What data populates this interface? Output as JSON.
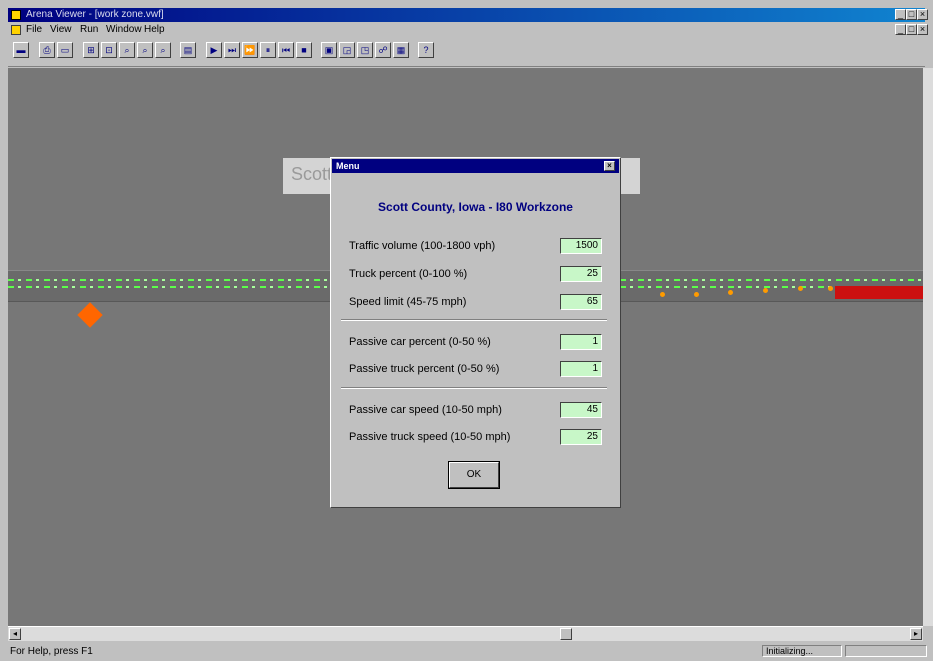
{
  "window": {
    "title": "Arena Viewer - [work zone.vwf]",
    "controls": [
      "_",
      "□",
      "×"
    ]
  },
  "menu": [
    "File",
    "View",
    "Run",
    "Window",
    "Help"
  ],
  "toolbar": {
    "icons": [
      "open-icon",
      "print-icon",
      "print-preview-icon",
      "zoom-fit-icon",
      "zoom-all-icon",
      "zoom-in-icon",
      "zoom-out-icon",
      "zoom-custom-icon",
      "animate-icon",
      "run-icon",
      "step-icon",
      "fast-forward-icon",
      "pause-icon",
      "go-icon",
      "stop-icon",
      "view-1-icon",
      "view-2-icon",
      "view-3-icon",
      "view-4-icon",
      "view-5-icon",
      "help-icon"
    ],
    "glyphs": [
      "▬",
      "⎙",
      "▭",
      "⊞",
      "⊡",
      "⌕",
      "⌕",
      "⌕",
      "▤",
      "▶",
      "⏭",
      "⏩",
      "⏸",
      "⏮",
      "■",
      "▣",
      "◲",
      "◳",
      "☍",
      "▦",
      "?"
    ]
  },
  "workspace": {
    "banner_text": "Scott",
    "colors": {
      "background": "#777777",
      "lane": "#5cff4a",
      "workzone": "#cc1010",
      "vehicle": "#ff9b00"
    }
  },
  "dialog": {
    "title": "Menu",
    "heading": "Scott County, Iowa - I80 Workzone",
    "fields": [
      {
        "label": "Traffic volume (100-1800 vph)",
        "value": "1500"
      },
      {
        "label": "Truck percent (0-100 %)",
        "value": "25"
      },
      {
        "label": "Speed limit (45-75 mph)",
        "value": "65"
      },
      {
        "label": "Passive car percent (0-50 %)",
        "value": "1"
      },
      {
        "label": "Passive truck percent (0-50 %)",
        "value": "1"
      },
      {
        "label": "Passive car speed (10-50 mph)",
        "value": "45"
      },
      {
        "label": "Passive truck speed (10-50 mph)",
        "value": "25"
      }
    ],
    "ok_label": "OK"
  },
  "status": {
    "help_text": "For Help, press F1",
    "panel_text": "Initializing..."
  }
}
